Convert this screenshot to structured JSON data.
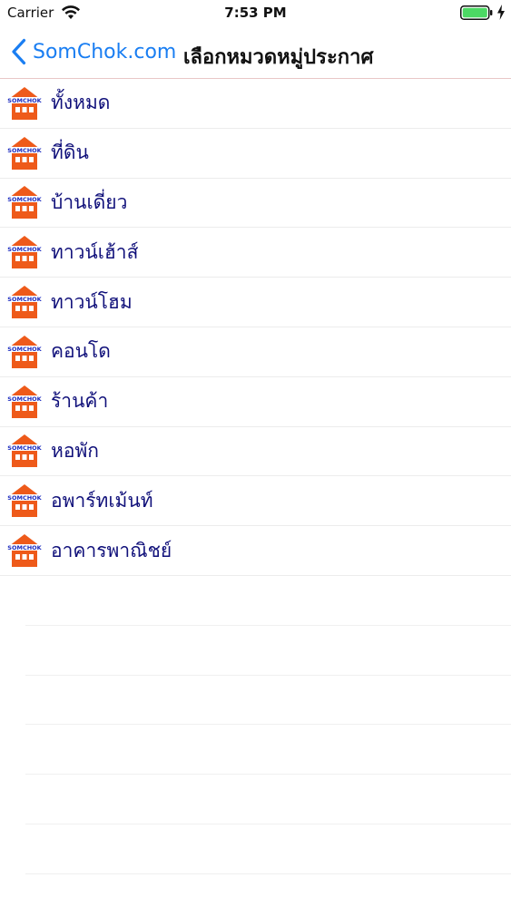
{
  "status_bar": {
    "carrier": "Carrier",
    "time": "7:53 PM",
    "wifi_icon": "wifi-icon",
    "battery_icon": "battery-icon",
    "charging_icon": "charging-bolt-icon",
    "battery_color": "#4cd964"
  },
  "nav": {
    "back_label": "SomChok.com",
    "title": "เลือกหมวดหมู่ประกาศ",
    "accent_color": "#1a7ef2"
  },
  "logo": {
    "text": "SOMCHOK",
    "roof_color": "#ee5a1a",
    "text_color": "#1b2bbf"
  },
  "categories": [
    {
      "label": "ทั้งหมด"
    },
    {
      "label": "ที่ดิน"
    },
    {
      "label": "บ้านเดี่ยว"
    },
    {
      "label": "ทาวน์เฮ้าส์"
    },
    {
      "label": "ทาวน์โฮม"
    },
    {
      "label": "คอนโด"
    },
    {
      "label": "ร้านค้า"
    },
    {
      "label": "หอพัก"
    },
    {
      "label": "อพาร์ทเม้นท์"
    },
    {
      "label": "อาคารพาณิชย์"
    }
  ]
}
